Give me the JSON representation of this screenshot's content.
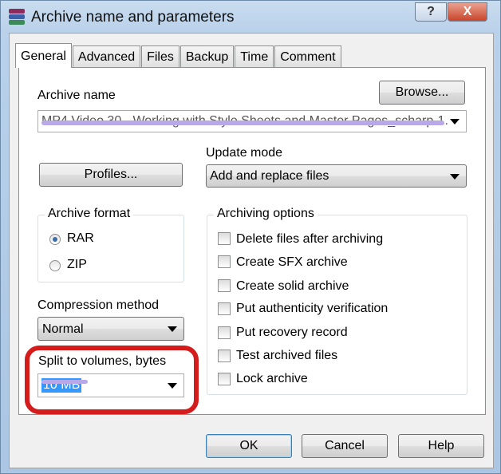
{
  "window": {
    "title": "Archive name and parameters",
    "help_label": "?",
    "close_label": "X"
  },
  "tabs": [
    {
      "label": "General",
      "active": true
    },
    {
      "label": "Advanced"
    },
    {
      "label": "Files"
    },
    {
      "label": "Backup"
    },
    {
      "label": "Time"
    },
    {
      "label": "Comment"
    }
  ],
  "archive_name": {
    "label": "Archive name",
    "value": "MP4 Video 30 - Working with Style Sheets and Master Pages_scharp-1.",
    "browse_label": "Browse..."
  },
  "profiles_label": "Profiles...",
  "update_mode": {
    "label": "Update mode",
    "value": "Add and replace files"
  },
  "archive_format": {
    "label": "Archive format",
    "options": [
      {
        "label": "RAR",
        "selected": true
      },
      {
        "label": "ZIP",
        "selected": false
      }
    ]
  },
  "compression": {
    "label": "Compression method",
    "value": "Normal"
  },
  "split": {
    "label": "Split to volumes, bytes",
    "value": "10 MB"
  },
  "archiving_options": {
    "label": "Archiving options",
    "items": [
      {
        "label": "Delete files after archiving",
        "checked": false
      },
      {
        "label": "Create SFX archive",
        "checked": false
      },
      {
        "label": "Create solid archive",
        "checked": false
      },
      {
        "label": "Put authenticity verification",
        "checked": false
      },
      {
        "label": "Put recovery record",
        "checked": false
      },
      {
        "label": "Test archived files",
        "checked": false
      },
      {
        "label": "Lock archive",
        "checked": false
      }
    ]
  },
  "buttons": {
    "ok": "OK",
    "cancel": "Cancel",
    "help": "Help"
  },
  "colors": {
    "highlight": "#d41c1c",
    "selection": "#3399ff",
    "scribble": "#b9a8e8"
  }
}
